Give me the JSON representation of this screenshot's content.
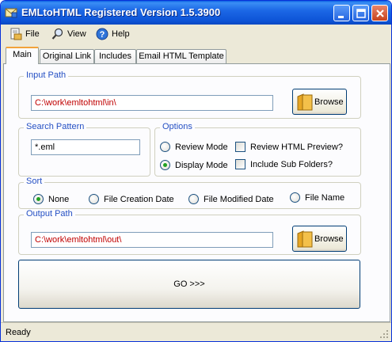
{
  "window": {
    "title": "EMLtoHTML Registered Version 1.5.3900"
  },
  "titlebar": {
    "minimize_icon": "minimize-icon",
    "maximize_icon": "maximize-icon",
    "close_icon": "close-icon"
  },
  "menu": {
    "items": [
      {
        "label": "File",
        "icon": "file-icon"
      },
      {
        "label": "View",
        "icon": "magnifier-icon"
      },
      {
        "label": "Help",
        "icon": "help-icon"
      }
    ]
  },
  "tabs": [
    {
      "label": "Main",
      "active": true
    },
    {
      "label": "Original Link",
      "active": false
    },
    {
      "label": "Includes",
      "active": false
    },
    {
      "label": "Email HTML Template",
      "active": false
    }
  ],
  "input_path": {
    "legend": "Input Path",
    "value": "C:\\work\\emltohtml\\in\\",
    "browse_label": "Browse"
  },
  "search_pattern": {
    "legend": "Search Pattern",
    "value": "*.eml"
  },
  "options": {
    "legend": "Options",
    "modes": [
      {
        "label": "Review Mode",
        "checked": false
      },
      {
        "label": "Display Mode",
        "checked": true
      }
    ],
    "checks": [
      {
        "label": "Review HTML Preview?",
        "checked": false
      },
      {
        "label": "Include Sub Folders?",
        "checked": false
      }
    ]
  },
  "sort": {
    "legend": "Sort",
    "choices": [
      {
        "label": "None",
        "checked": true
      },
      {
        "label": "File Creation Date",
        "checked": false
      },
      {
        "label": "File Modified Date",
        "checked": false
      },
      {
        "label": "File Name",
        "checked": false
      }
    ]
  },
  "output_path": {
    "legend": "Output Path",
    "value": "C:\\work\\emltohtml\\out\\",
    "browse_label": "Browse"
  },
  "go_button": {
    "label": "GO >>>"
  },
  "status": {
    "text": "Ready"
  },
  "colors": {
    "titlebar_blue": "#0d53d6",
    "legend_blue": "#2550c4",
    "path_text_red": "#c00000",
    "radio_green": "#21a121",
    "tab_highlight_orange": "#f2a33a"
  }
}
